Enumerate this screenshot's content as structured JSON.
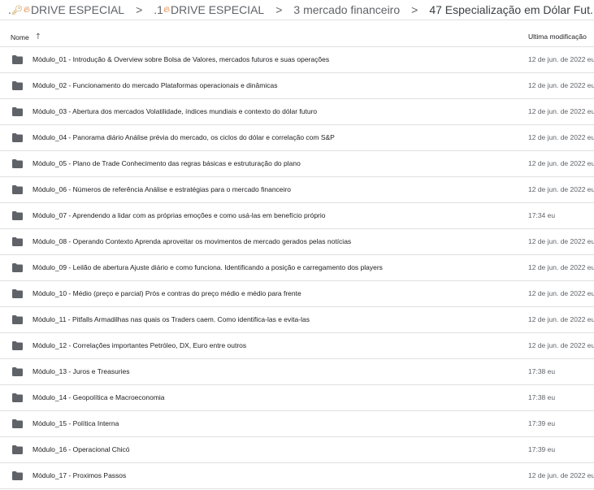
{
  "breadcrumb": {
    "items": [
      {
        "prefix": ".",
        "label": "DRIVE ESPECIAL",
        "icons": [
          "key-icon",
          "flame-icon"
        ]
      },
      {
        "prefix": ".1",
        "label": "DRIVE ESPECIAL",
        "icons": [
          "flame-icon"
        ]
      },
      {
        "prefix": "",
        "label": "3 mercado financeiro",
        "icons": []
      },
      {
        "prefix": "",
        "label": "47 Especialização em Dólar Fut...",
        "icons": []
      }
    ],
    "separator": ">"
  },
  "table": {
    "col_name": "Nome",
    "col_modified": "Ultima modificação",
    "sort_icon": "arrow-up-icon",
    "rows": [
      {
        "name": "Módulo_01 - Introdução & Overview sobre Bolsa de Valores, mercados futuros e suas operações",
        "modified": "12 de jun. de 2022 eu"
      },
      {
        "name": "Módulo_02 - Funcionamento do mercado Plataformas operacionais e dinâmicas",
        "modified": "12 de jun. de 2022 eu"
      },
      {
        "name": "Módulo_03 - Abertura dos mercados Volatilidade, índices mundiais e contexto do dólar futuro",
        "modified": "12 de jun. de 2022 eu"
      },
      {
        "name": "Módulo_04 - Panorama diário Análise prévia do mercado, os ciclos do dólar e correlação com S&P",
        "modified": "12 de jun. de 2022 eu"
      },
      {
        "name": "Módulo_05 - Plano de Trade Conhecimento das regras básicas e estruturação do plano",
        "modified": "12 de jun. de 2022 eu"
      },
      {
        "name": "Módulo_06 - Números de referência Análise e estratégias para o mercado financeiro",
        "modified": "12 de jun. de 2022 eu"
      },
      {
        "name": "Módulo_07 - Aprendendo a lidar com as próprias emoções e como usá-las em benefício próprio",
        "modified": "17:34 eu"
      },
      {
        "name": "Módulo_08 - Operando Contexto Aprenda aproveitar os movimentos de mercado gerados pelas notícias",
        "modified": "12 de jun. de 2022 eu"
      },
      {
        "name": "Módulo_09 - Leilão de abertura Ajuste diário e como funciona. Identificando a posição e carregamento dos players",
        "modified": "12 de jun. de 2022 eu"
      },
      {
        "name": "Módulo_10 - Médio (preço e parcial) Prós e contras do preço médio e médio para frente",
        "modified": "12 de jun. de 2022 eu"
      },
      {
        "name": "Módulo_11 - Pitfalls Armadilhas nas quais os Traders caem. Como identifica-las e evita-las",
        "modified": "12 de jun. de 2022 eu"
      },
      {
        "name": "Módulo_12 - Correlações importantes Petróleo, DX, Euro entre outros",
        "modified": "12 de jun. de 2022 eu"
      },
      {
        "name": "Módulo_13 - Juros e Treasuries",
        "modified": "17:38 eu"
      },
      {
        "name": "Módulo_14 - Geopolítica e Macroeconomia",
        "modified": "17:38 eu"
      },
      {
        "name": "Módulo_15 - Política Interna",
        "modified": "17:39 eu"
      },
      {
        "name": "Módulo_16 - Operacional Chicó",
        "modified": "17:39 eu"
      },
      {
        "name": "Módulo_17 - Proximos Passos",
        "modified": "12 de jun. de 2022 eu"
      }
    ]
  },
  "colors": {
    "folder_icon": "#5f6368",
    "divider": "#e0e0e0",
    "text": "#3c4043",
    "key": "#c0892b",
    "flame": "#e06a16"
  }
}
